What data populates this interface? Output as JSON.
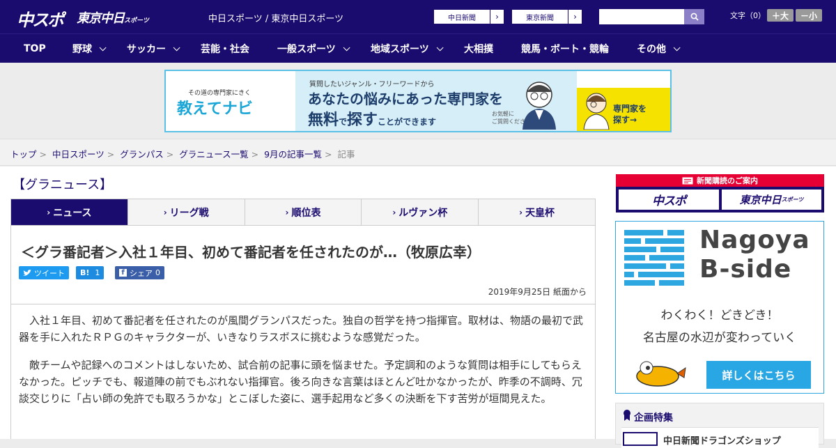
{
  "header": {
    "logo_chuspo": "中スポ",
    "logo_tokyo": "東京中日",
    "logo_tokyo_small": "スポーツ",
    "site_name": "中日スポーツ / 東京中日スポーツ",
    "paper_links": [
      "中日新聞",
      "東京新聞"
    ],
    "search_placeholder": "",
    "font_label": "文字（0）",
    "font_increase": "＋大",
    "font_decrease": "－小"
  },
  "nav": {
    "items": [
      {
        "label": "TOP",
        "has_menu": false
      },
      {
        "label": "野球",
        "has_menu": true
      },
      {
        "label": "サッカー",
        "has_menu": true
      },
      {
        "label": "芸能・社会",
        "has_menu": false
      },
      {
        "label": "一般スポーツ",
        "has_menu": true
      },
      {
        "label": "地域スポーツ",
        "has_menu": true
      },
      {
        "label": "大相撲",
        "has_menu": false
      },
      {
        "label": "競馬・ボート・競輪",
        "has_menu": false
      },
      {
        "label": "その他",
        "has_menu": true
      }
    ]
  },
  "banner": {
    "tagline": "その道の専門家にきく",
    "brand": "教えてナビ",
    "line1": "質問したいジャンル・フリーワードから",
    "line2": "あなたの悩みにあった専門家を",
    "line3a": "無料",
    "line3b": "で",
    "line3c": "探す",
    "line3d": "ことができます",
    "note": "お気軽に\nご質問ください！",
    "cta": "専門家を\n探す→"
  },
  "breadcrumb": {
    "items": [
      "トップ",
      "中日スポーツ",
      "グランパス",
      "グラニュース一覧",
      "9月の記事一覧"
    ],
    "current": "記事",
    "separator": ">"
  },
  "main": {
    "section_title": "【グラニュース】",
    "tabs": [
      {
        "label": "ニュース",
        "active": true
      },
      {
        "label": "リーグ戦",
        "active": false
      },
      {
        "label": "順位表",
        "active": false
      },
      {
        "label": "ルヴァン杯",
        "active": false
      },
      {
        "label": "天皇杯",
        "active": false
      }
    ],
    "tab_arrow": "›"
  },
  "article": {
    "headline": "＜グラ番記者＞入社１年目、初めて番記者を任されたのが…（牧原広幸）",
    "share": {
      "tweet": "ツイート",
      "hatena_label": "B!",
      "hatena_count": "1",
      "facebook": "シェア",
      "facebook_count": "0"
    },
    "date": "2019年9月25日 紙面から",
    "paragraphs": [
      "入社１年目、初めて番記者を任されたのが風間グランパスだった。独自の哲学を持つ指揮官。取材は、物語の最初で武器を手に入れたＲＰＧのキャラクターが、いきなりラスボスに挑むような感覚だった。",
      "敵チームや記録へのコメントはしないため、試合前の記事に頭を悩ませた。予定調和のような質問は相手にしてもらえなかった。ピッチでも、報道陣の前でもぶれない指揮官。後ろ向きな言葉はほとんど吐かなかったが、昨季の不調時、冗談交じりに「占い師の免許でも取ろうかな」とこぼした姿に、選手起用など多くの決断を下す苦労が垣間見えた。"
    ]
  },
  "sidebar": {
    "subscribe_head": "新聞購読のご案内",
    "subscribe_logos": [
      "中スポ",
      "東京中日"
    ],
    "subscribe_logo_small": "スポーツ",
    "nagoya_title_1": "Nagoya",
    "nagoya_title_2": "B-side",
    "nagoya_sub_1": "わくわく！どきどき！",
    "nagoya_sub_2": "名古屋の水辺が変わっていく",
    "nagoya_cta": "詳しくはこちら",
    "special_title": "企画特集",
    "special_item": "中日新聞ドラゴンズショップ"
  },
  "colors": {
    "brand_navy": "#1a0b6e",
    "accent_red": "#e60033",
    "accent_blue": "#29a6e4",
    "banner_yellow": "#f5e200"
  }
}
